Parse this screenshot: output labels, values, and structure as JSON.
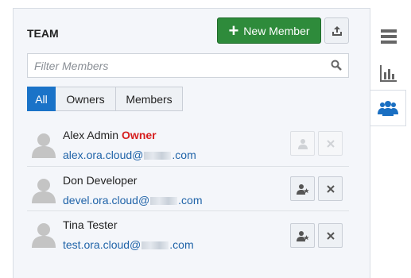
{
  "team": {
    "title": "TEAM",
    "new_member_label": "New Member",
    "filter_placeholder": "Filter Members"
  },
  "filters": [
    "All",
    "Owners",
    "Members"
  ],
  "members": [
    {
      "name": "Alex Admin",
      "role_badge": "Owner",
      "email_prefix": "alex.ora.cloud@",
      "email_suffix": ".com"
    },
    {
      "name": "Don Developer",
      "role_badge": "",
      "email_prefix": "devel.ora.cloud@",
      "email_suffix": ".com"
    },
    {
      "name": "Tina Tester",
      "role_badge": "",
      "email_prefix": "test.ora.cloud@",
      "email_suffix": ".com"
    }
  ],
  "icons": {
    "new_member": "plus-icon",
    "upload": "upload-icon",
    "search": "search-icon",
    "avatar": "person-silhouette-icon",
    "make_owner": "person-star-icon",
    "remove": "close-icon",
    "sidebar": [
      "list-icon",
      "bar-chart-icon",
      "team-icon"
    ]
  },
  "colors": {
    "primary_green": "#2e8b3b",
    "selected_blue": "#1a73c8",
    "owner_red": "#d61e1e",
    "link_blue": "#1f63a8"
  }
}
